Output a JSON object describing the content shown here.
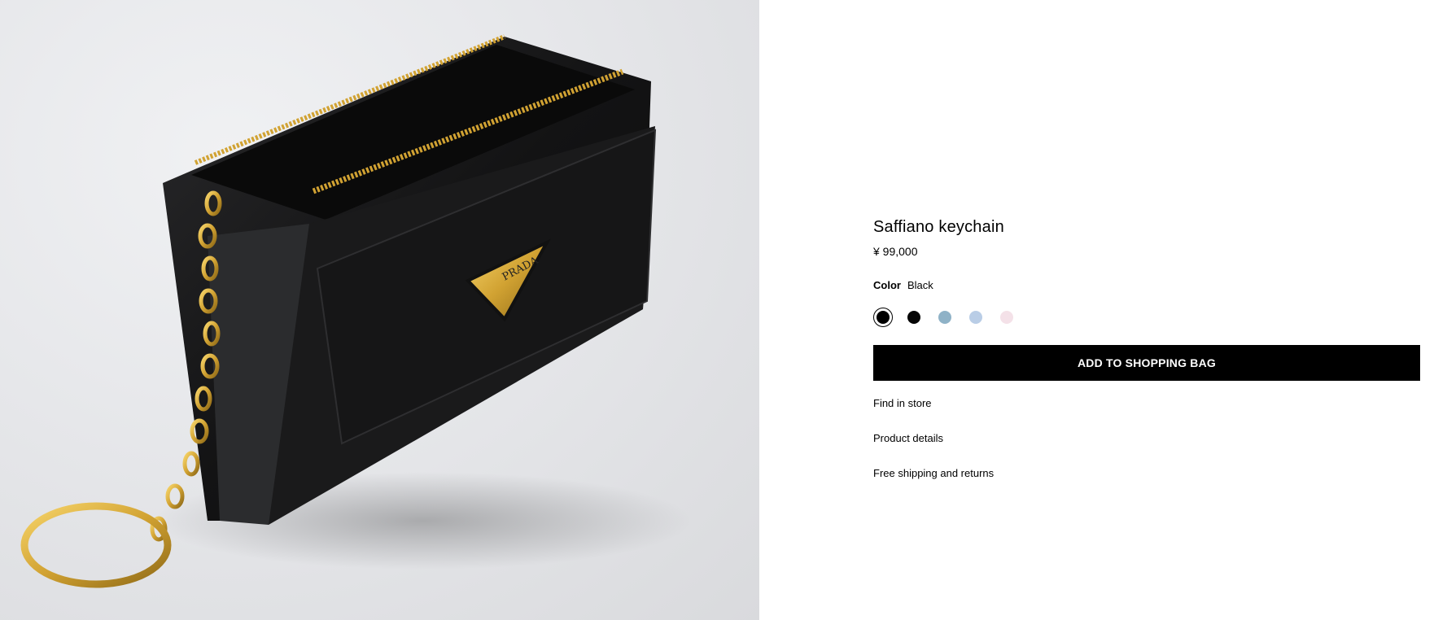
{
  "product": {
    "title": "Saffiano keychain",
    "price": "¥ 99,000",
    "image_alt": "Black Saffiano leather keychain wallet with gold chain and ring",
    "logo_text": "PRADA"
  },
  "color": {
    "label": "Color",
    "selected": "Black",
    "swatches": [
      {
        "name": "Black",
        "hex": "#000000",
        "selected": true
      },
      {
        "name": "Black",
        "hex": "#050505",
        "selected": false
      },
      {
        "name": "Light blue",
        "hex": "#8fb2c7",
        "selected": false
      },
      {
        "name": "Cornflower",
        "hex": "#b9cde6",
        "selected": false
      },
      {
        "name": "Pink",
        "hex": "#f4e1e8",
        "selected": false
      }
    ]
  },
  "actions": {
    "add_to_bag": "ADD TO SHOPPING BAG",
    "find_in_store": "Find in store",
    "product_details": "Product details",
    "shipping": "Free shipping and returns"
  }
}
